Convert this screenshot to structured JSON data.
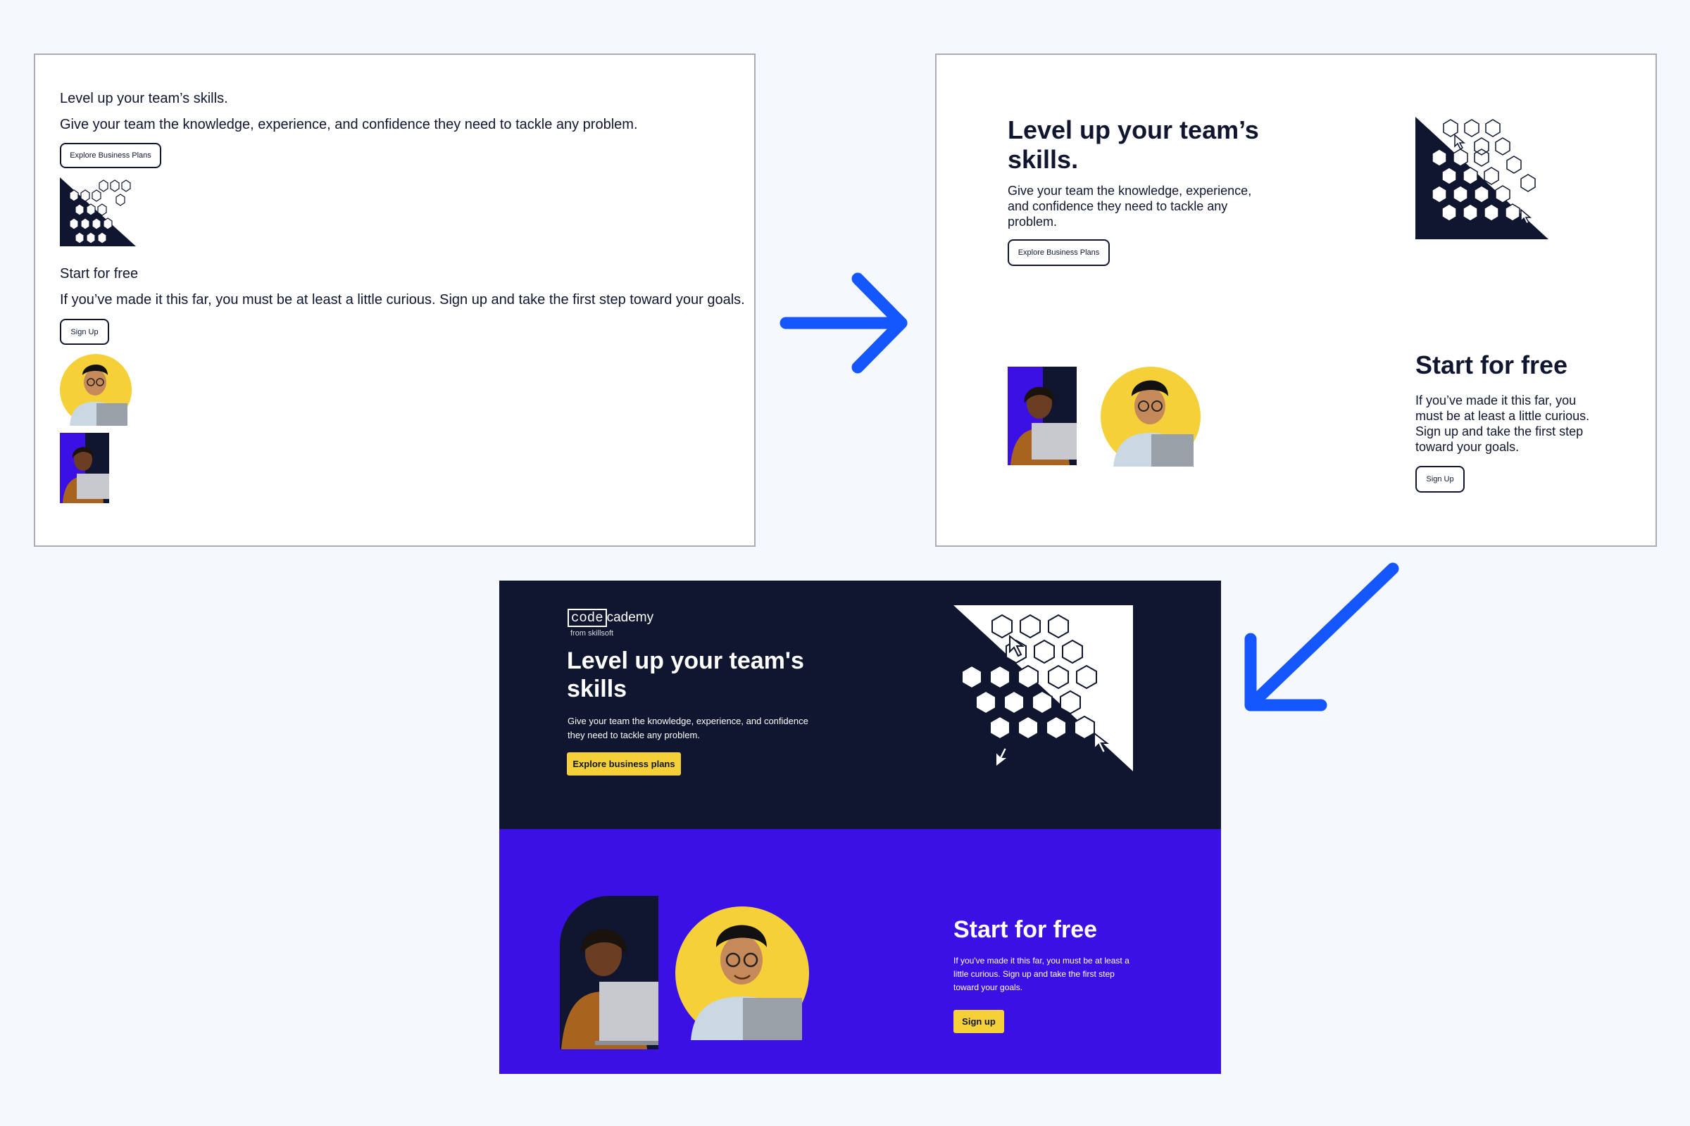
{
  "step1": {
    "heading": "Level up your team’s skills.",
    "body": "Give your team the knowledge, experience, and confidence they need to tackle any problem.",
    "button": "Explore Business Plans",
    "heading2": "Start for free",
    "body2": "If you’ve made it this far, you must be at least a little curious. Sign up and take the first step toward your goals.",
    "button2": "Sign Up"
  },
  "step2": {
    "heading": "Level up your team’s skills.",
    "body": "Give your team the knowledge, experience, and confidence they need to tackle any problem.",
    "button": "Explore Business Plans",
    "heading2": "Start for free",
    "body2": "If you’ve made it this far, you must be at least a little curious. Sign up and take the first step toward your goals.",
    "button2": "Sign Up"
  },
  "final": {
    "logo_code": "code",
    "logo_cademy": "cademy",
    "logo_sub": "from skillsoft",
    "heading": "Level up your team's skills",
    "body": "Give your team the knowledge, experience, and confidence they need to tackle any problem.",
    "button": "Explore business plans",
    "heading2": "Start for free",
    "body2": "If you've made it this far, you must be at least a little curious. Sign up and take the first step toward your goals.",
    "button2": "Sign up"
  },
  "colors": {
    "page_bg": "#f5f9fd",
    "navy": "#10162f",
    "hyper_blue": "#3a10e5",
    "yellow": "#f5d038",
    "arrow_blue": "#1557ff"
  },
  "icons": [
    "arrow-right-icon",
    "arrow-down-left-icon",
    "hexagon-grid-illustration",
    "cursor-icon"
  ]
}
